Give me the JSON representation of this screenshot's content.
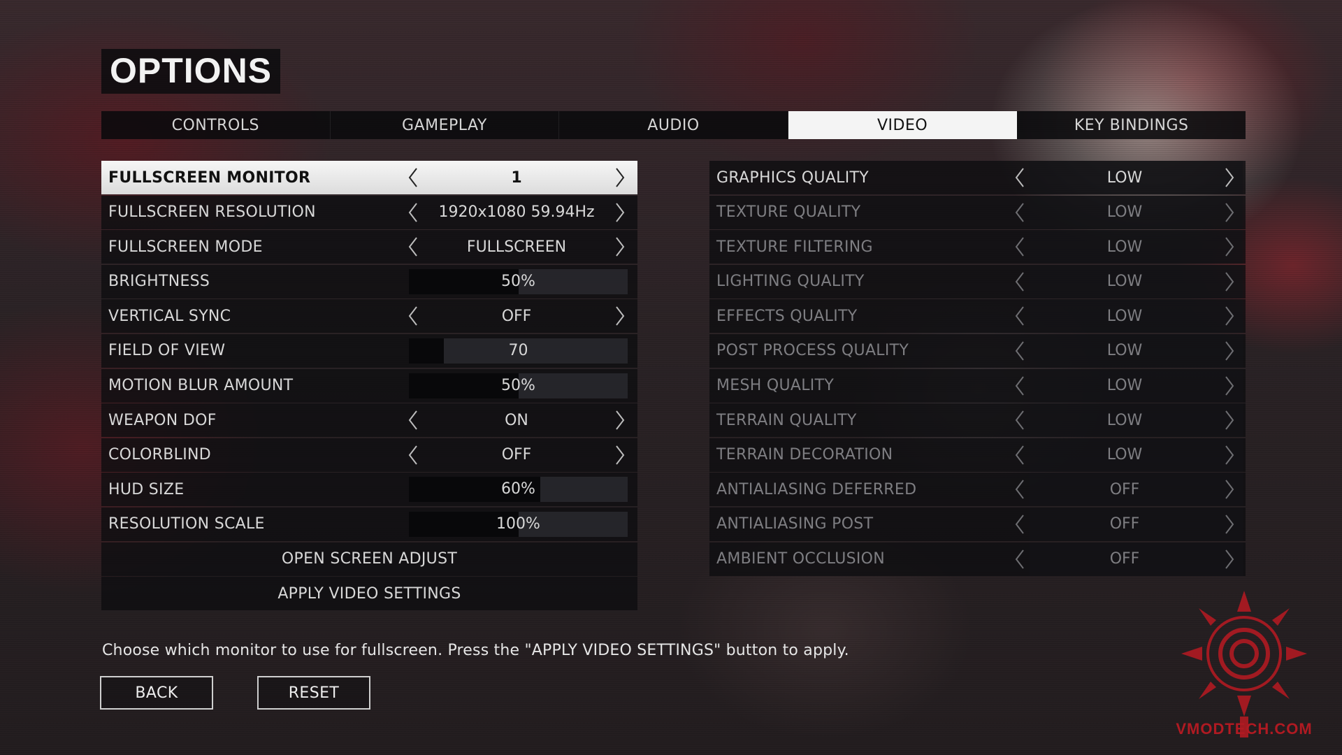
{
  "title": "OPTIONS",
  "tabs": [
    {
      "label": "CONTROLS",
      "active": false
    },
    {
      "label": "GAMEPLAY",
      "active": false
    },
    {
      "label": "AUDIO",
      "active": false
    },
    {
      "label": "VIDEO",
      "active": true
    },
    {
      "label": "KEY BINDINGS",
      "active": false
    }
  ],
  "left_settings": [
    {
      "label": "FULLSCREEN MONITOR",
      "kind": "select",
      "value": "1",
      "selected": true
    },
    {
      "label": "FULLSCREEN RESOLUTION",
      "kind": "select",
      "value": "1920x1080 59.94Hz"
    },
    {
      "label": "FULLSCREEN MODE",
      "kind": "select",
      "value": "FULLSCREEN"
    },
    {
      "label": "BRIGHTNESS",
      "kind": "slider",
      "value": "50%",
      "level": 0.5
    },
    {
      "label": "VERTICAL SYNC",
      "kind": "select",
      "value": "OFF"
    },
    {
      "label": "FIELD OF VIEW",
      "kind": "slider",
      "value": "70",
      "level": 0.16
    },
    {
      "label": "MOTION BLUR AMOUNT",
      "kind": "slider",
      "value": "50%",
      "level": 0.5
    },
    {
      "label": "WEAPON DOF",
      "kind": "select",
      "value": "ON"
    },
    {
      "label": "COLORBLIND",
      "kind": "select",
      "value": "OFF"
    },
    {
      "label": "HUD SIZE",
      "kind": "slider",
      "value": "60%",
      "level": 0.6
    },
    {
      "label": "RESOLUTION SCALE",
      "kind": "slider",
      "value": "100%",
      "level": 0.5
    }
  ],
  "actions": {
    "open_screen_adjust": "OPEN SCREEN ADJUST",
    "apply_video_settings": "APPLY VIDEO SETTINGS"
  },
  "right_settings": [
    {
      "label": "GRAPHICS QUALITY",
      "value": "LOW",
      "enabled": true
    },
    {
      "label": "TEXTURE QUALITY",
      "value": "LOW",
      "enabled": false
    },
    {
      "label": "TEXTURE FILTERING",
      "value": "LOW",
      "enabled": false
    },
    {
      "label": "LIGHTING QUALITY",
      "value": "LOW",
      "enabled": false
    },
    {
      "label": "EFFECTS QUALITY",
      "value": "LOW",
      "enabled": false
    },
    {
      "label": "POST PROCESS QUALITY",
      "value": "LOW",
      "enabled": false
    },
    {
      "label": "MESH QUALITY",
      "value": "LOW",
      "enabled": false
    },
    {
      "label": "TERRAIN QUALITY",
      "value": "LOW",
      "enabled": false
    },
    {
      "label": "TERRAIN DECORATION",
      "value": "LOW",
      "enabled": false
    },
    {
      "label": "ANTIALIASING DEFERRED",
      "value": "OFF",
      "enabled": false
    },
    {
      "label": "ANTIALIASING POST",
      "value": "OFF",
      "enabled": false
    },
    {
      "label": "AMBIENT OCCLUSION",
      "value": "OFF",
      "enabled": false
    }
  ],
  "hint": "Choose which monitor to use for fullscreen. Press the \"APPLY VIDEO SETTINGS\" button to apply.",
  "buttons": {
    "back": "BACK",
    "reset": "RESET"
  },
  "watermark": {
    "text": "VMODTECH.COM",
    "color": "#b01a22"
  },
  "colors": {
    "selected_row": "#f4f4f4",
    "panel": "#0e0e10",
    "text": "#d8d8d8",
    "disabled_text": "#7e7e82"
  },
  "icons": {
    "prev": "chevron-left-icon",
    "next": "chevron-right-icon"
  }
}
